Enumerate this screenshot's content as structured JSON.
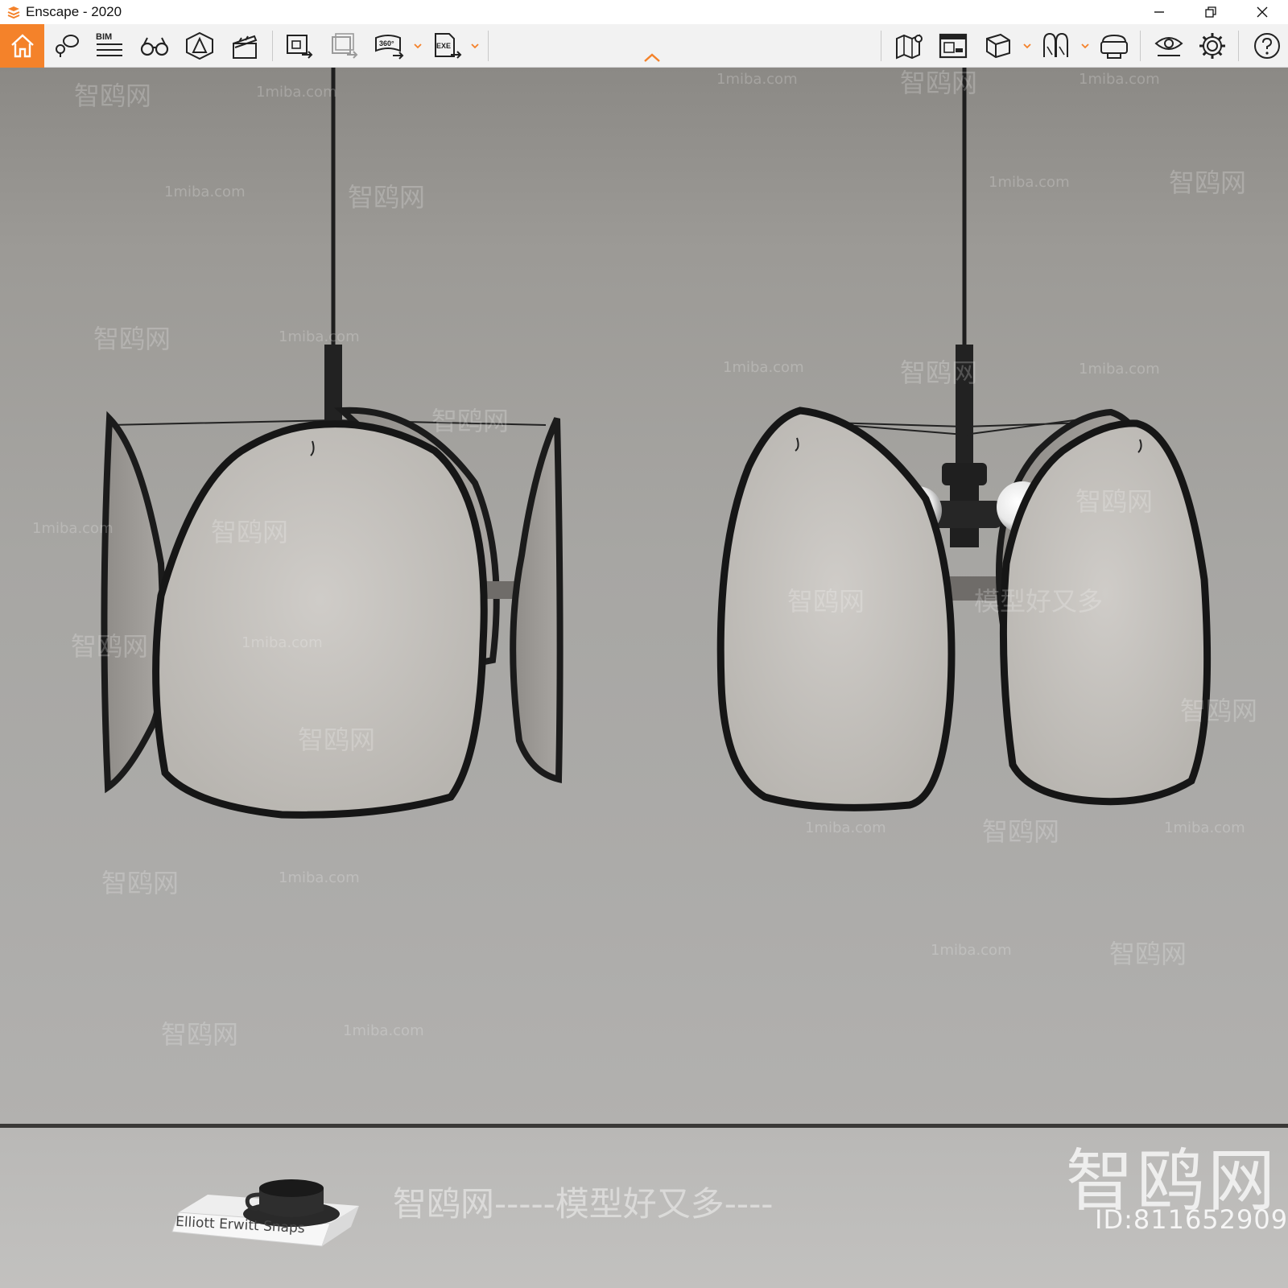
{
  "window": {
    "title": "Enscape - 2020",
    "controls": [
      "minimize-icon",
      "restore-icon",
      "close-icon"
    ]
  },
  "toolbar": {
    "accent_color": "#f4822a",
    "bim_label": "BIM",
    "left_tools": [
      {
        "name": "home",
        "icon": "home-icon"
      },
      {
        "name": "views",
        "icon": "location-pin-icon"
      },
      {
        "name": "bim-info",
        "icon": "bim-list-icon"
      },
      {
        "name": "explore",
        "icon": "binoculars-icon"
      },
      {
        "name": "atmosphere",
        "icon": "bell-icon"
      },
      {
        "name": "video-editor",
        "icon": "clapper-icon"
      },
      {
        "name": "render-export",
        "icon": "render-export-icon"
      },
      {
        "name": "batch-render",
        "icon": "batch-render-icon"
      },
      {
        "name": "panorama-360",
        "icon": "panorama-360-icon"
      },
      {
        "name": "exe-export",
        "icon": "exe-export-icon"
      }
    ],
    "right_tools": [
      {
        "name": "map",
        "icon": "map-pin-icon"
      },
      {
        "name": "gallery",
        "icon": "gallery-icon"
      },
      {
        "name": "asset-library",
        "icon": "cube-icon"
      },
      {
        "name": "material-editor",
        "icon": "materials-icon"
      },
      {
        "name": "vr",
        "icon": "vr-headset-icon"
      },
      {
        "name": "visual-settings",
        "icon": "eye-icon"
      },
      {
        "name": "settings",
        "icon": "gear-icon"
      },
      {
        "name": "help",
        "icon": "help-icon"
      }
    ]
  },
  "viewport": {
    "watermark_cn": "智鸥网",
    "watermark_en": "1miba.com",
    "slogan": "智鸥网-----模型好又多----",
    "slogan_short": "模型好又多",
    "big_logo": "智鸥网",
    "id_text": "ID:811652909",
    "book_title": "Elliott Erwitt Snaps"
  }
}
